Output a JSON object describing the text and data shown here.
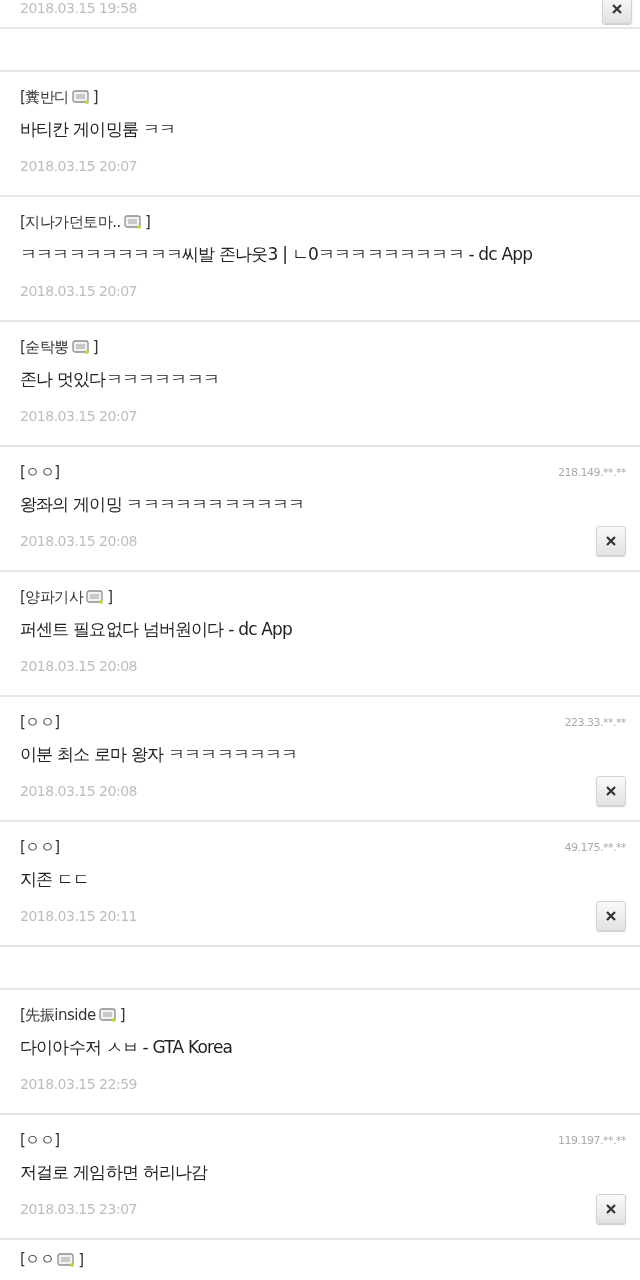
{
  "items": [
    {
      "kind": "partial",
      "date": "2018.03.15 19:58",
      "deletable": true
    },
    {
      "kind": "spacer"
    },
    {
      "kind": "comment",
      "nick": "[糞반디",
      "gallog": true,
      "close": "]",
      "text": "바티칸 게이밍룸 ㅋㅋ",
      "date": "2018.03.15 20:07",
      "deletable": false
    },
    {
      "kind": "comment",
      "nick": "[지나가던토마..",
      "gallog": true,
      "close": "]",
      "text": "ㅋㅋㅋㅋㅋㅋㅋㅋㅋㅋ씨발 존나웃3 | ㄴ0ㅋㅋㅋㅋㅋㅋㅋㅋㅋ - dc App",
      "date": "2018.03.15 20:07",
      "deletable": false
    },
    {
      "kind": "comment",
      "nick": "[숟탁뿡",
      "gallog": true,
      "close": "]",
      "text": "존나 멋있다ㅋㅋㅋㅋㅋㅋㅋ",
      "date": "2018.03.15 20:07",
      "deletable": false
    },
    {
      "kind": "comment",
      "nick": "[ㅇㅇ]",
      "gallog": false,
      "ip": "218.149.**.**",
      "text": "왕좌의 게이밍 ㅋㅋㅋㅋㅋㅋㅋㅋㅋㅋㅋ",
      "date": "2018.03.15 20:08",
      "deletable": true
    },
    {
      "kind": "comment",
      "nick": "[양파기사",
      "gallog": true,
      "close": "]",
      "text": "퍼센트 필요없다 넘버원이다 - dc App",
      "date": "2018.03.15 20:08",
      "deletable": false
    },
    {
      "kind": "comment",
      "nick": "[ㅇㅇ]",
      "gallog": false,
      "ip": "223.33.**.**",
      "text": "이분 최소 로마 왕자 ㅋㅋㅋㅋㅋㅋㅋㅋ",
      "date": "2018.03.15 20:08",
      "deletable": true
    },
    {
      "kind": "comment",
      "nick": "[ㅇㅇ]",
      "gallog": false,
      "ip": "49.175.**.**",
      "text": "지존 ㄷㄷ",
      "date": "2018.03.15 20:11",
      "deletable": true
    },
    {
      "kind": "spacer"
    },
    {
      "kind": "comment",
      "nick": "[先振inside",
      "gallog": true,
      "close": "]",
      "text": "다이아수저 ㅅㅂ - GTA Korea",
      "date": "2018.03.15 22:59",
      "deletable": false
    },
    {
      "kind": "comment",
      "nick": "[ㅇㅇ]",
      "gallog": false,
      "ip": "119.197.**.**",
      "text": "저걸로 게임하면 허리나감",
      "date": "2018.03.15 23:07",
      "deletable": true
    },
    {
      "kind": "tail",
      "nick": "[ㅇㅇ",
      "gallog": true,
      "close": "]"
    }
  ]
}
